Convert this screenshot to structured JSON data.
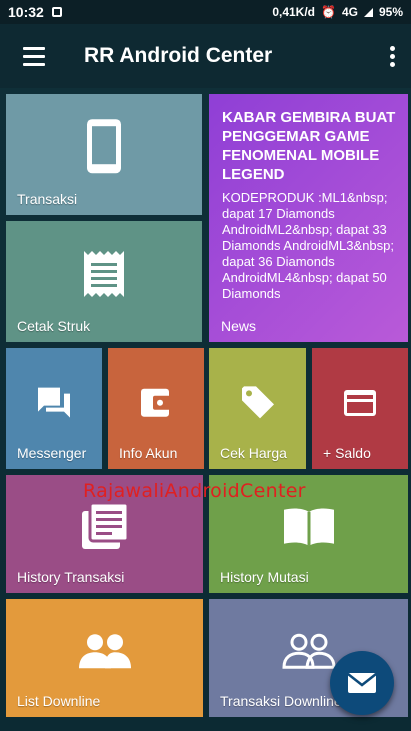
{
  "status_bar": {
    "time": "10:32",
    "network_speed": "0,41K/d",
    "network_type": "4G",
    "battery": "95%"
  },
  "app_bar": {
    "title": "RR Android Center",
    "menu_icon": "hamburger-icon",
    "overflow_icon": "more-vert-icon"
  },
  "tiles": [
    {
      "id": "transaksi",
      "label": "Transaksi",
      "icon": "phone-icon",
      "color": "#6f9aa6"
    },
    {
      "id": "cetak-struk",
      "label": "Cetak Struk",
      "icon": "receipt-icon",
      "color": "#5f9386"
    },
    {
      "id": "messenger",
      "label": "Messenger",
      "icon": "chat-icon",
      "color": "#4f86ad"
    },
    {
      "id": "info-akun",
      "label": "Info Akun",
      "icon": "wallet-icon",
      "color": "#c8643d"
    },
    {
      "id": "cek-harga",
      "label": "Cek Harga",
      "icon": "tag-icon",
      "color": "#a8b24a"
    },
    {
      "id": "saldo",
      "label": "+ Saldo",
      "icon": "card-icon",
      "color": "#b03a44"
    },
    {
      "id": "history-transaksi",
      "label": "History Transaksi",
      "icon": "library-icon",
      "color": "#9a4d86"
    },
    {
      "id": "history-mutasi",
      "label": "History Mutasi",
      "icon": "book-icon",
      "color": "#6fa04a"
    },
    {
      "id": "list-downline",
      "label": "List Downline",
      "icon": "people-icon",
      "color": "#e39a3c"
    },
    {
      "id": "transaksi-downline",
      "label": "Transaksi Downline",
      "icon": "people-outline-icon",
      "color": "#6f7aa0"
    }
  ],
  "news": {
    "title": "KABAR GEMBIRA BUAT PENGGEMAR GAME FENOMENAL MOBILE LEGEND",
    "body": "KODEPRODUK :ML1&nbsp; dapat 17 Diamonds AndroidML2&nbsp; dapat 33 Diamonds AndroidML3&nbsp; dapat 36 Diamonds AndroidML4&nbsp; dapat 50 Diamonds",
    "label": "News",
    "color_from": "#8f3fd6",
    "color_to": "#b95ad8"
  },
  "watermark": "RajawaliAndroidCenter",
  "fab": {
    "icon": "mail-icon",
    "color": "#0d4a7a"
  }
}
